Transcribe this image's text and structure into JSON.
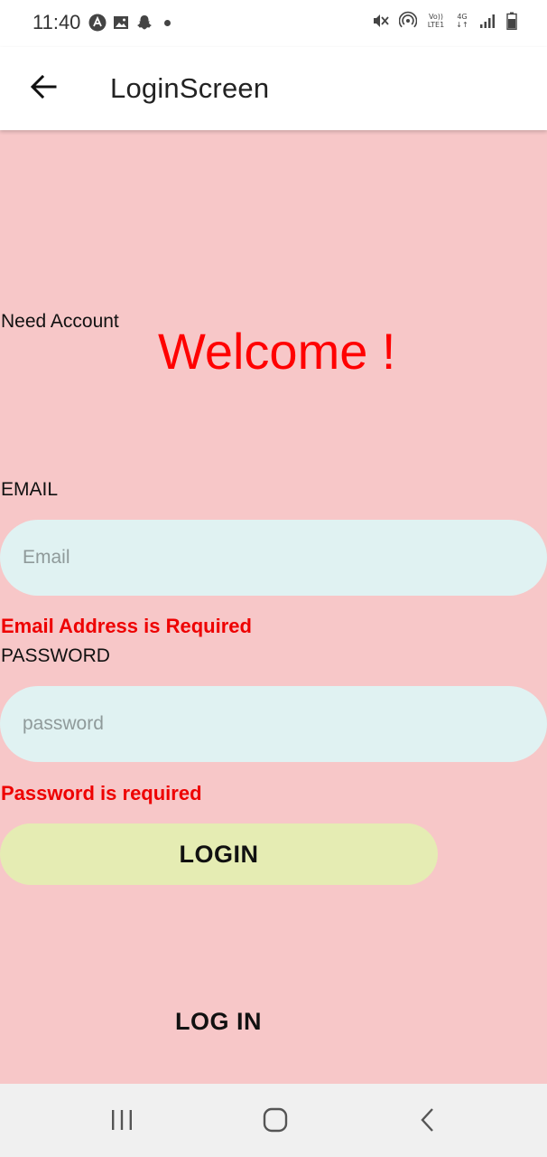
{
  "status_bar": {
    "time": "11:40",
    "left_icons": [
      "app-a-icon",
      "image-icon",
      "snapchat-icon",
      "dot-icon"
    ],
    "right_icons": [
      "mute-vibrate-icon",
      "hotspot-icon",
      "volte-lte-icon",
      "4g-data-icon",
      "signal-icon",
      "battery-icon"
    ],
    "volte_top": "Vo))",
    "volte_bottom": "LTE1",
    "data_label": "4G"
  },
  "app_bar": {
    "title": "LoginScreen"
  },
  "body": {
    "background_color": "#f7c7c8",
    "need_account": "Need Account",
    "welcome": "Welcome !",
    "email_label": "EMAIL",
    "email_placeholder": "Email",
    "email_value": "",
    "email_error": "Email Address is Required",
    "password_label": "PASSWORD",
    "password_placeholder": "password",
    "password_value": "",
    "password_error": "Password is required",
    "login_button": "LOGIN",
    "login_link": "LOG IN"
  },
  "colors": {
    "error": "#ee0000",
    "welcome": "#ff0000",
    "input_bg": "#e0f2f2",
    "button_bg": "#e5ecb3"
  },
  "nav_bar": {
    "buttons": [
      "recent-apps-icon",
      "home-icon",
      "back-nav-icon"
    ]
  }
}
